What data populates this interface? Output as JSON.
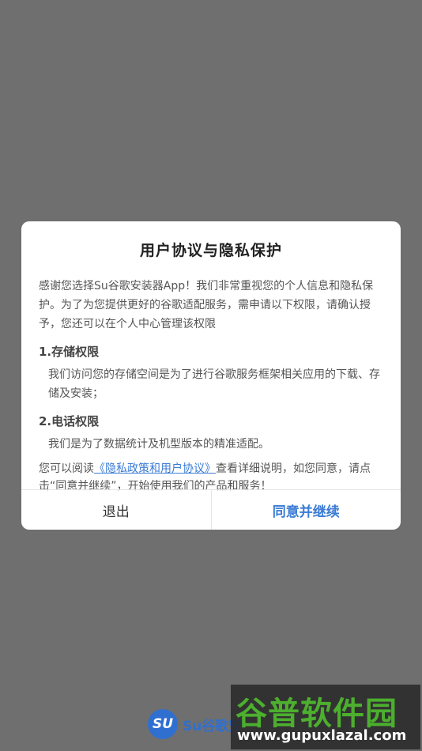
{
  "dialog": {
    "title": "用户协议与隐私保护",
    "intro": "感谢您选择Su谷歌安装器App！我们非常重视您的个人信息和隐私保护。为了为您提供更好的谷歌适配服务，需申请以下权限，请确认授予，您还可以在个人中心管理该权限",
    "permissions": [
      {
        "title": "1.存储权限",
        "desc": "我们访问您的存储空间是为了进行谷歌服务框架相关应用的下载、存储及安装；"
      },
      {
        "title": "2.电话权限",
        "desc": "我们是为了数据统计及机型版本的精准适配。"
      }
    ],
    "consent": {
      "prefix": "您可以阅读",
      "link": "《隐私政策和用户协议》",
      "suffix": "查看详细说明，如您同意，请点击“同意并继续”，开始使用我们的产品和服务！"
    },
    "buttons": {
      "exit": "退出",
      "agree": "同意并继续"
    }
  },
  "brand": {
    "logo_text": "SU",
    "name": "Su谷歌安"
  },
  "watermark": {
    "text": "谷普软件园",
    "url": "www.gupuxlazal.com"
  },
  "colors": {
    "accent": "#3a7bd5",
    "overlay": "#6f6f6f"
  }
}
